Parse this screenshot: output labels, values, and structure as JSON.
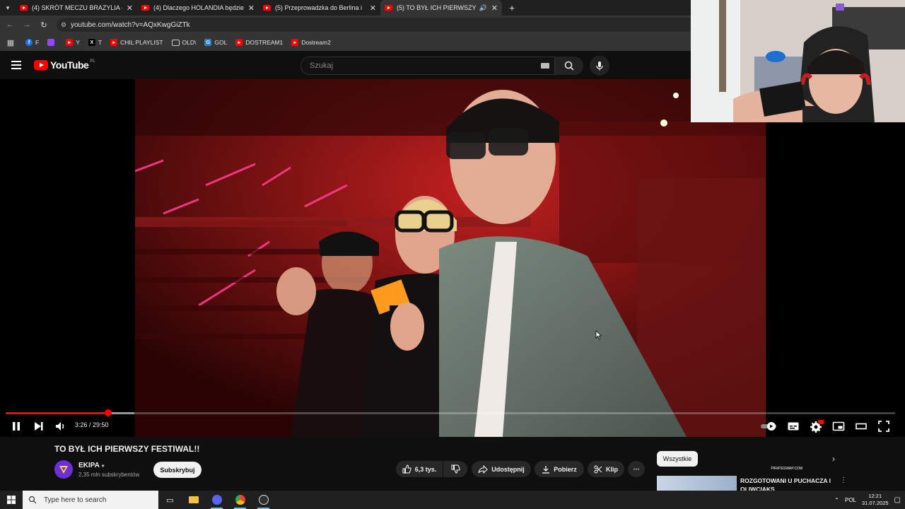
{
  "browser": {
    "tabs": [
      {
        "title": "(4) SKRÓT MECZU BRAZYLIA - C"
      },
      {
        "title": "(4) Dlaczego HOLANDIA będzie"
      },
      {
        "title": "(5) Przeprowadzka do Berlina i"
      },
      {
        "title": "(5) TO BYŁ ICH PIERWSZY F"
      }
    ],
    "url": "youtube.com/watch?v=AQxKwgGiZTk",
    "bookmarks": [
      {
        "label": "F",
        "icon": "facebook-icon"
      },
      {
        "label": "",
        "icon": "twitch-icon"
      },
      {
        "label": "Y",
        "icon": "youtube-icon"
      },
      {
        "label": "T",
        "icon": "x-icon"
      },
      {
        "label": "CHIL PLAYLIST",
        "icon": "youtube-icon"
      },
      {
        "label": "OLD\\",
        "icon": "folder-icon"
      },
      {
        "label": "GOL",
        "icon": "gol-icon"
      },
      {
        "label": "DOSTREAM1",
        "icon": "youtube-icon"
      },
      {
        "label": "Dostream2",
        "icon": "youtube-icon"
      }
    ]
  },
  "youtube": {
    "logo_text": "YouTube",
    "country_code": "PL",
    "search_placeholder": "Szukaj",
    "accent": "#ff0000"
  },
  "player": {
    "time": "3:26 / 29:50",
    "progress_fraction": 0.1151,
    "settings_badge": "HD"
  },
  "video": {
    "title": "TO BYŁ ICH PIERWSZY FESTIWAL!!",
    "channel": "EKIPA",
    "subscribers": "2,35 mln subskrybentów",
    "subscribe_label": "Subskrybuj",
    "likes": "6,3 tys.",
    "share_label": "Udostępnij",
    "download_label": "Pobierz",
    "clip_label": "Klip"
  },
  "sidebar": {
    "chip": "Wszystkie",
    "ad_text": "PIRATESWAP.COM",
    "rec_title_line1": "ROZGOTOWANI U PUCHACZA I",
    "rec_title_line2": "OLIWCIAKS"
  },
  "taskbar": {
    "search_placeholder": "Type here to search",
    "language": "POL",
    "time": "12:21",
    "date": "31.07.2025"
  }
}
